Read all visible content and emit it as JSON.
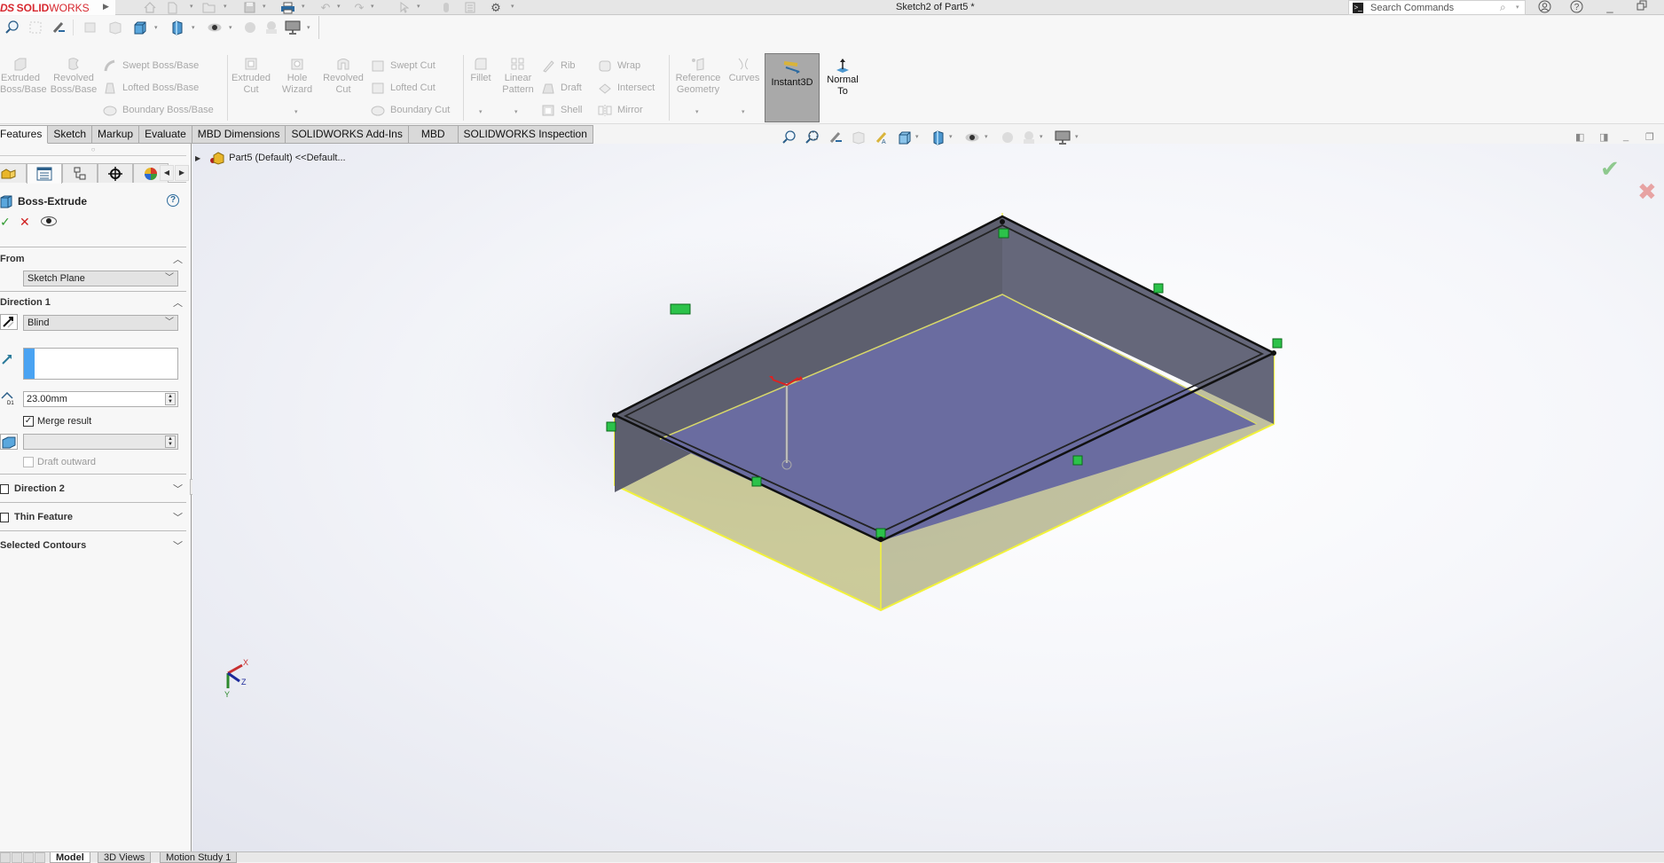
{
  "app": {
    "logo_ds": "DS",
    "logo_solid": "SOLID",
    "logo_works": "WORKS",
    "document_title": "Sketch2 of Part5 *"
  },
  "quick_access": [
    {
      "icon": "home-icon"
    },
    {
      "icon": "new-document-icon"
    },
    {
      "icon": "open-folder-icon"
    },
    {
      "icon": "save-icon"
    },
    {
      "icon": "print-icon"
    },
    {
      "icon": "undo-icon"
    },
    {
      "icon": "redo-icon"
    },
    {
      "icon": "select-pointer-icon"
    },
    {
      "icon": "rebuild-icon"
    },
    {
      "icon": "file-properties-icon"
    },
    {
      "icon": "options-gear-icon"
    }
  ],
  "search": {
    "placeholder": "Search Commands"
  },
  "command_manager": {
    "features_big": [
      {
        "label_1": "Extruded",
        "label_2": "Boss/Base"
      },
      {
        "label_1": "Revolved",
        "label_2": "Boss/Base"
      }
    ],
    "features_small": [
      "Swept Boss/Base",
      "Lofted Boss/Base",
      "Boundary Boss/Base"
    ],
    "cuts_big": [
      {
        "label_1": "Extruded",
        "label_2": "Cut"
      },
      {
        "label_1": "Hole",
        "label_2": "Wizard"
      },
      {
        "label_1": "Revolved",
        "label_2": "Cut"
      }
    ],
    "cuts_small": [
      "Swept Cut",
      "Lofted Cut",
      "Boundary Cut"
    ],
    "modify_big": [
      {
        "label_1": "Fillet",
        "label_2": ""
      },
      {
        "label_1": "Linear",
        "label_2": "Pattern"
      }
    ],
    "modify_small_col1": [
      "Rib",
      "Draft",
      "Shell"
    ],
    "modify_small_col2": [
      "Wrap",
      "Intersect",
      "Mirror"
    ],
    "ref_big": [
      {
        "label_1": "Reference",
        "label_2": "Geometry"
      },
      {
        "label_1": "Curves",
        "label_2": ""
      }
    ],
    "instant3d": "Instant3D",
    "normal_to_1": "Normal",
    "normal_to_2": "To"
  },
  "tabs": [
    {
      "label": "Features",
      "active": true
    },
    {
      "label": "Sketch"
    },
    {
      "label": "Markup"
    },
    {
      "label": "Evaluate"
    },
    {
      "label": "MBD Dimensions"
    },
    {
      "label": "SOLIDWORKS Add-Ins"
    },
    {
      "label": "MBD"
    },
    {
      "label": "SOLIDWORKS Inspection"
    }
  ],
  "property_manager": {
    "title": "Boss-Extrude",
    "help": "?",
    "ok": "✓",
    "cancel": "✕",
    "from": {
      "label": "From",
      "value": "Sketch Plane"
    },
    "direction1": {
      "label": "Direction 1",
      "end_condition": "Blind",
      "depth": "23.00mm",
      "merge_result_label": "Merge result",
      "merge_result_checked": true,
      "draft_outward_label": "Draft outward",
      "draft_outward_checked": false
    },
    "direction2": {
      "label": "Direction 2",
      "checked": false
    },
    "thin_feature": {
      "label": "Thin Feature",
      "checked": false
    },
    "selected_contours": {
      "label": "Selected Contours"
    }
  },
  "feature_tree": {
    "root_label": "Part5 (Default) <<Default..."
  },
  "triad": {
    "x": "X",
    "y": "Y",
    "z": "Z"
  },
  "bottom_tabs": [
    {
      "label": "Model",
      "active": true
    },
    {
      "label": "3D Views"
    },
    {
      "label": "Motion Study 1"
    }
  ],
  "colors": {
    "brand_red": "#d7282f",
    "instant3d_bg": "#a9a9a9",
    "selection_blue": "#4aa3f2",
    "preview_yellow": "#e8e84a",
    "floor_face": "#6a6ca0",
    "wall_face": "#5d5f6e"
  }
}
